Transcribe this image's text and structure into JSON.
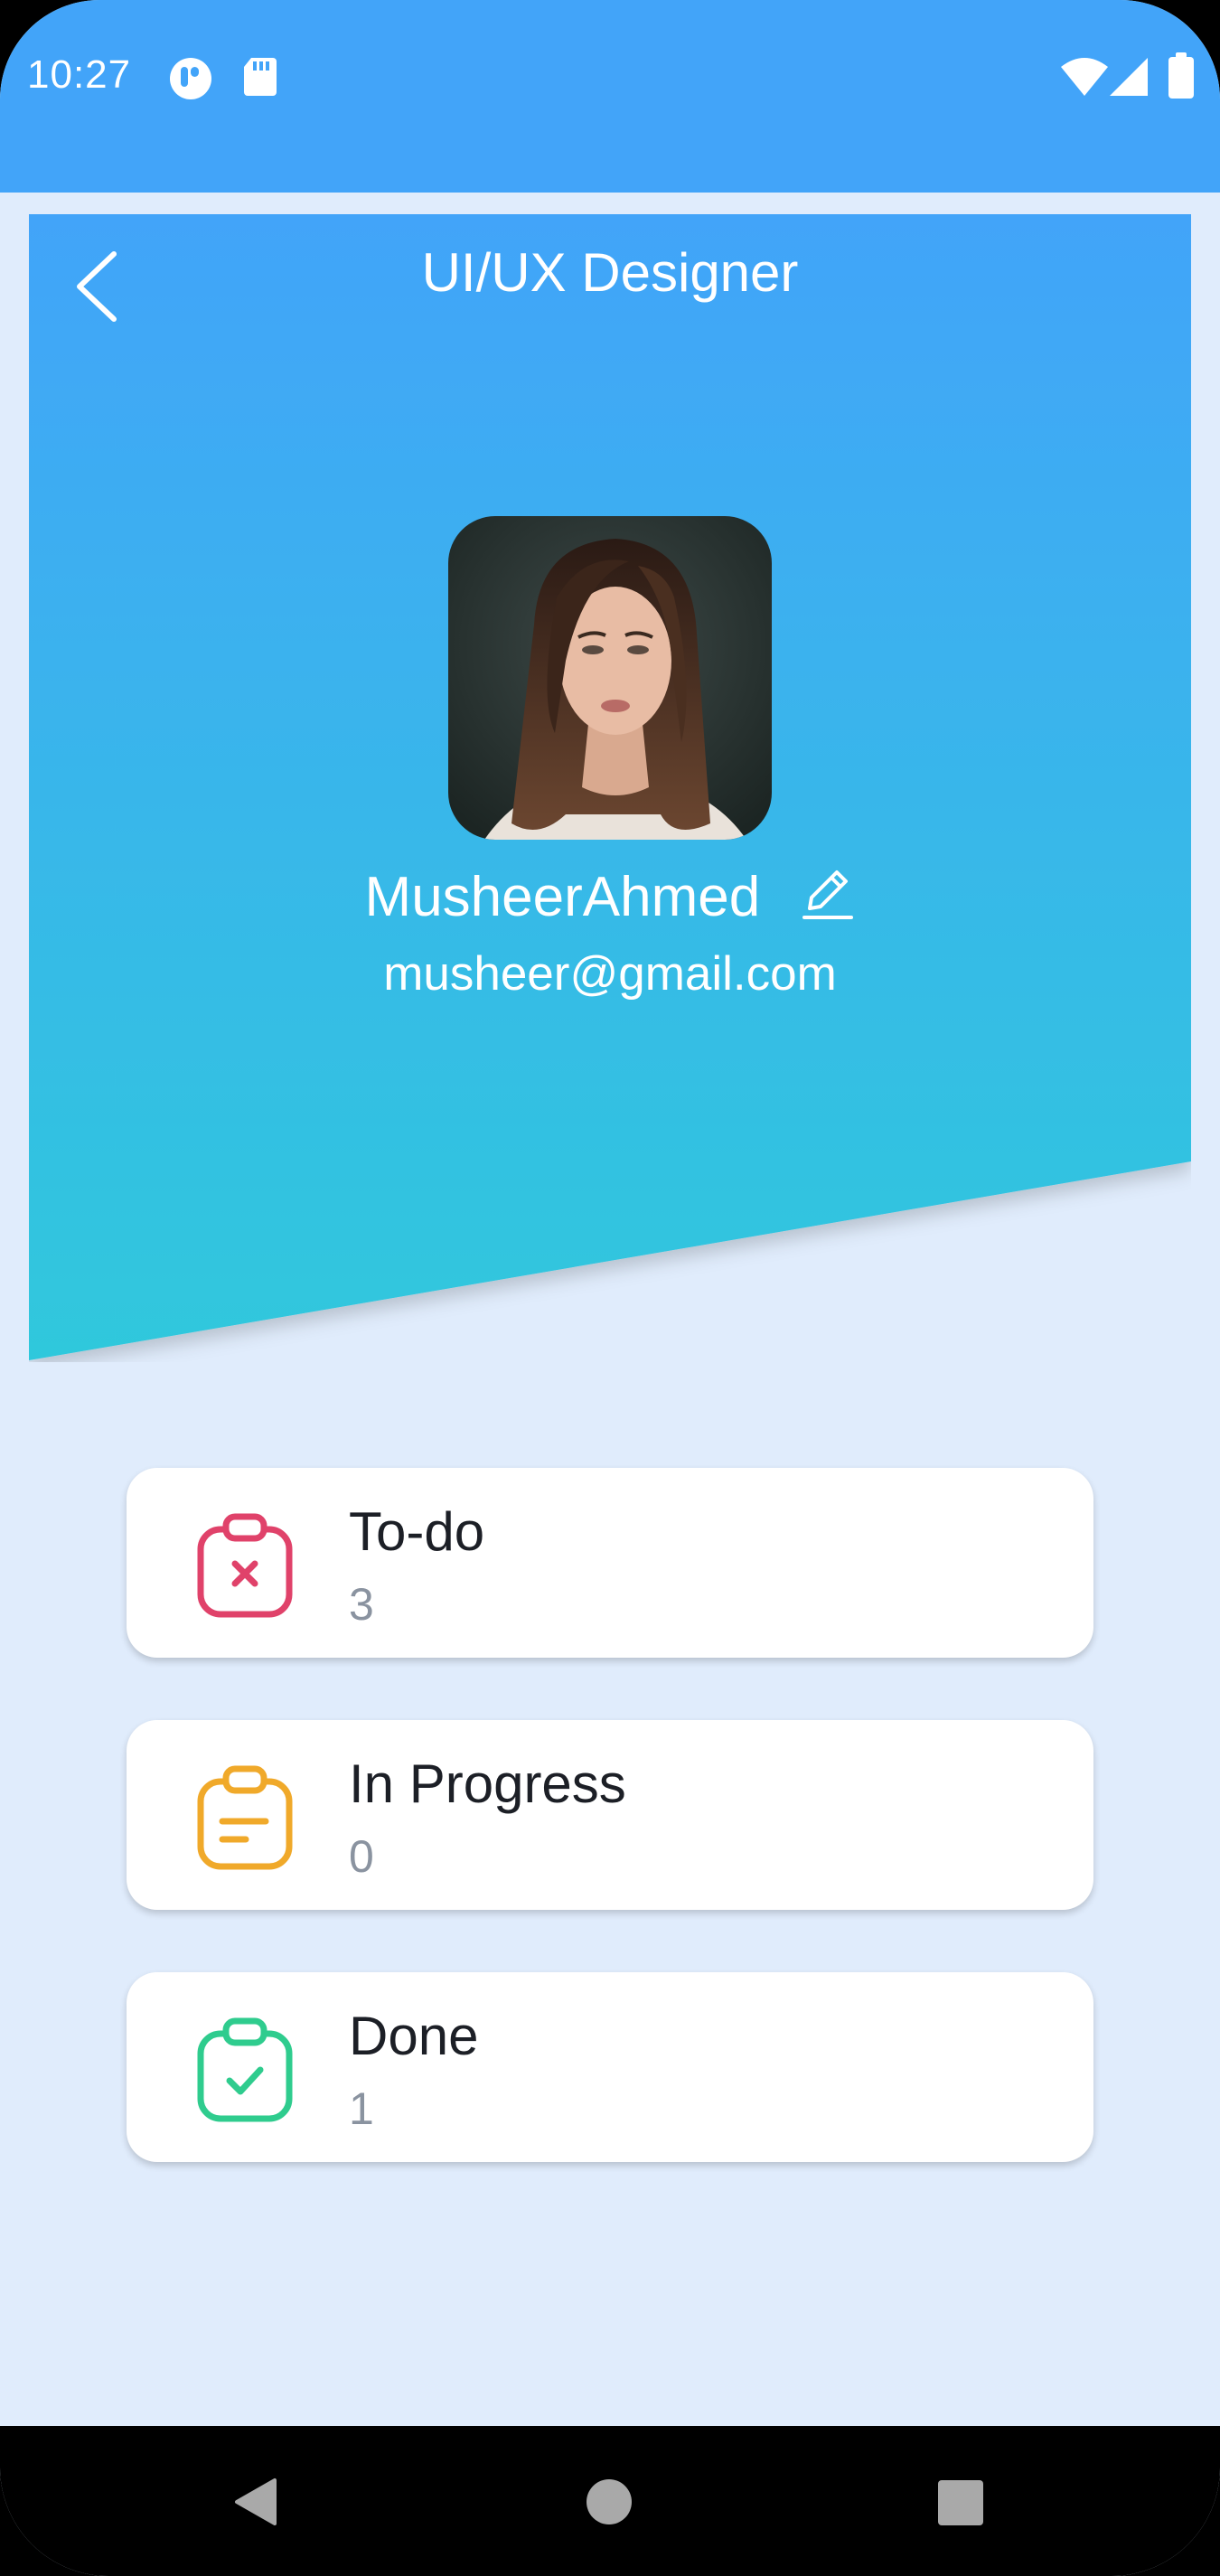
{
  "status_bar": {
    "time": "10:27",
    "icons": [
      "app-notification-icon",
      "sd-card-icon",
      "wifi-icon",
      "cellular-signal-icon",
      "battery-icon"
    ],
    "color": "#42a4f9"
  },
  "header": {
    "title": "UI/UX Designer",
    "back_icon": "chevron-left-icon",
    "gradient_top": "#42a4f9",
    "gradient_bottom": "#2fc8dc"
  },
  "profile": {
    "name": "MusheerAhmed",
    "email": "musheer@gmail.com",
    "edit_icon": "pencil-icon",
    "avatar_alt": "profile-photo"
  },
  "task_cards": [
    {
      "label": "To-do",
      "count": "3",
      "icon": "clipboard-x-icon",
      "color": "#e0426a"
    },
    {
      "label": "In Progress",
      "count": "0",
      "icon": "clipboard-list-icon",
      "color": "#f0a92a"
    },
    {
      "label": "Done",
      "count": "1",
      "icon": "clipboard-check-icon",
      "color": "#2fcc8e"
    }
  ],
  "nav_bar": {
    "buttons": [
      "back-triangle-icon",
      "home-circle-icon",
      "recents-square-icon"
    ]
  },
  "colors": {
    "page_background": "#e0ecfc",
    "card_background": "#ffffff"
  }
}
